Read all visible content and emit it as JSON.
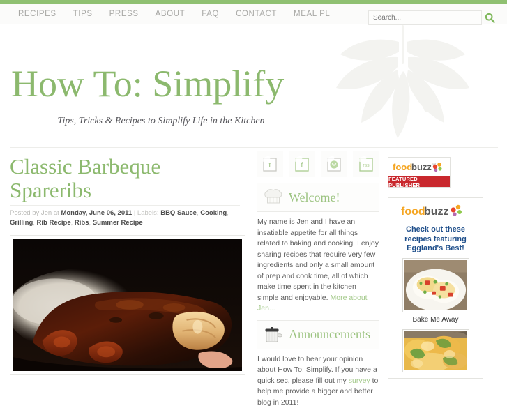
{
  "theme": {
    "accent_green": "#8cb96e",
    "topbar_green": "#8fc071",
    "nav_text": "#a8a8a5",
    "badge_red": "#c9282d",
    "ad_blue": "#1f4f8b"
  },
  "nav": {
    "items": [
      {
        "label": "RECIPES"
      },
      {
        "label": "TIPS"
      },
      {
        "label": "PRESS"
      },
      {
        "label": "ABOUT"
      },
      {
        "label": "FAQ"
      },
      {
        "label": "CONTACT"
      },
      {
        "label": "MEAL PL"
      }
    ]
  },
  "search": {
    "placeholder": "Search...",
    "value": "",
    "icon": "search-icon"
  },
  "header": {
    "title": "How To: Simplify",
    "tagline": "Tips, Tricks & Recipes to Simplify Life in the Kitchen",
    "background_art": "leaf-branch-watermark"
  },
  "post": {
    "title": "Classic Barbeque Spareribs",
    "meta": {
      "posted_by_prefix": "Posted by",
      "author": "Jen",
      "at": "at",
      "date": "Monday, June 06, 2011",
      "separator": "|",
      "labels_prefix": "Labels:",
      "labels": [
        "BBQ Sauce",
        "Cooking",
        "Grilling",
        "Rib Recipe",
        "Ribs",
        "Summer Recipe"
      ]
    },
    "image_alt": "Barbeque spareribs glazed with dark sauce on a white plate"
  },
  "social": {
    "items": [
      {
        "name": "twitter-icon",
        "glyph": "t"
      },
      {
        "name": "facebook-icon",
        "glyph": "f"
      },
      {
        "name": "email-icon",
        "glyph": "✉"
      },
      {
        "name": "rss-icon",
        "glyph": "rss"
      }
    ]
  },
  "welcome": {
    "icon": "chef-hat-icon",
    "title": "Welcome!",
    "body": "My name is Jen and I have an insatiable appetite for all things related to baking and cooking. I enjoy sharing recipes that require very few ingredients and only a small amount of prep and cook time, all of which make time spent in the kitchen simple and enjoyable. ",
    "link": "More about Jen..."
  },
  "announcements": {
    "icon": "stockpot-icon",
    "title": "Announcements",
    "body_before": "I would love to hear your opinion about How To: Simplify. If you have a quick sec, please fill out my ",
    "link": "survey",
    "body_after": " to help me provide a bigger and better blog in 2011!"
  },
  "foodbuzz_badge": {
    "logo_food": "food",
    "logo_buzz": "buzz",
    "logo_sm": "SM",
    "ribbon": "FEATURED PUBLISHER"
  },
  "foodbuzz_ad": {
    "logo_food": "food",
    "logo_buzz": "buzz",
    "headline_line1": "Check out these",
    "headline_line2": "recipes featuring",
    "headline_line3": "Eggland's Best!",
    "thumb1_alt": "Egg and vegetable scramble on a white plate",
    "caption1": "Bake Me Away",
    "thumb2_alt": "Cheesy baked casserole dish"
  }
}
